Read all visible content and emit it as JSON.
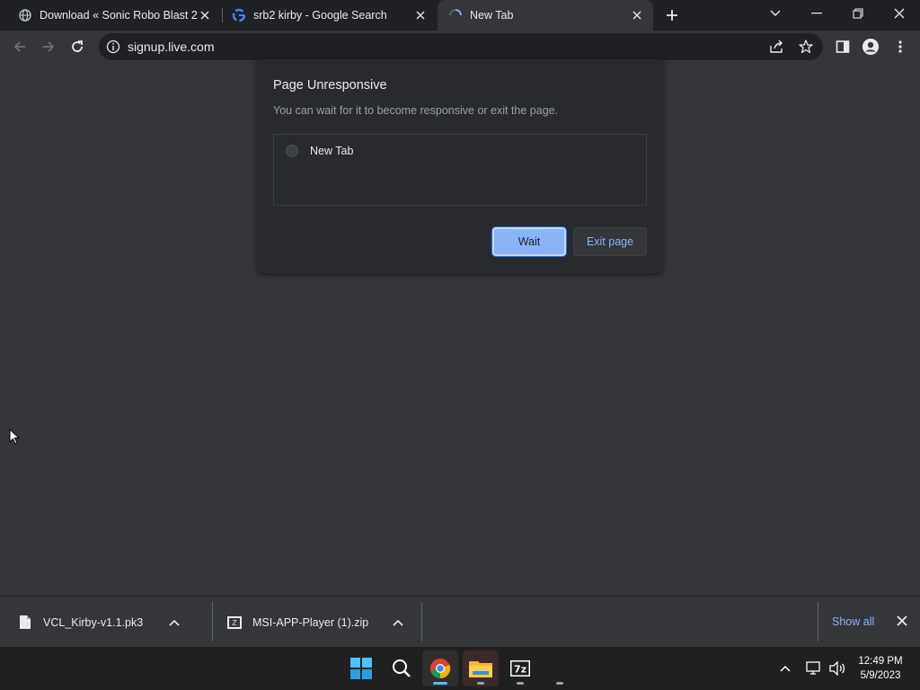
{
  "tabs": [
    {
      "title": "Download « Sonic Robo Blast 2 –",
      "icon": "globe-icon"
    },
    {
      "title": "srb2 kirby - Google Search",
      "icon": "google-icon"
    },
    {
      "title": "New Tab",
      "icon": "loading-spinner-icon"
    }
  ],
  "address_bar": {
    "url": "signup.live.com"
  },
  "dialog": {
    "title": "Page Unresponsive",
    "description": "You can wait for it to become responsive or exit the page.",
    "pages": [
      {
        "label": "New Tab"
      }
    ],
    "wait_label": "Wait",
    "exit_label": "Exit page"
  },
  "downloads": {
    "items": [
      {
        "name": "VCL_Kirby-v1.1.pk3",
        "icon": "file-icon"
      },
      {
        "name": "MSI-APP-Player (1).zip",
        "icon": "zip-file-icon"
      }
    ],
    "show_all_label": "Show all"
  },
  "taskbar": {
    "time": "12:49 PM",
    "date": "5/9/2023"
  },
  "colors": {
    "accent": "#8ab4f8",
    "dialog_bg": "#292a2d",
    "content_bg": "#35363a"
  }
}
